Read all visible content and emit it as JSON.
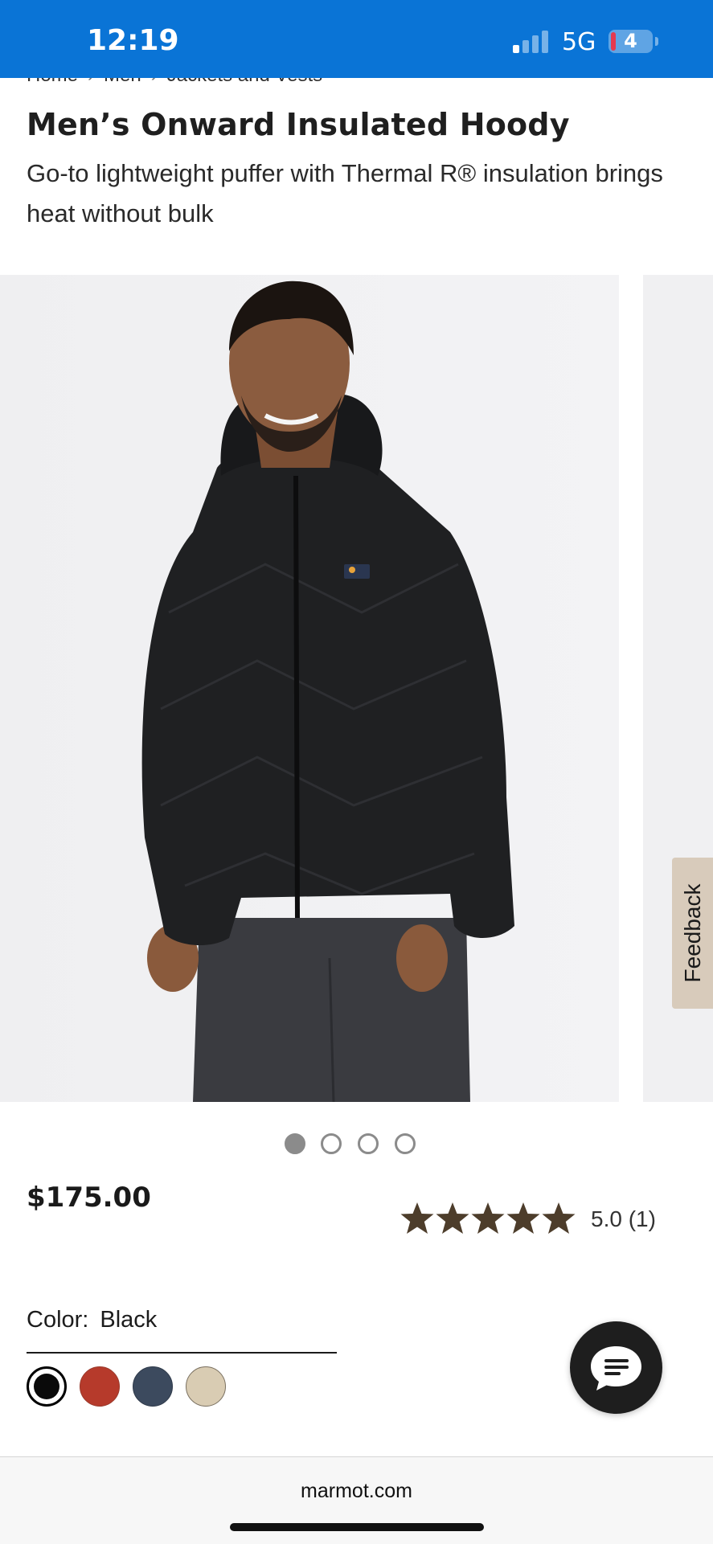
{
  "status_bar": {
    "time": "12:19",
    "network": "5G",
    "battery": "4"
  },
  "breadcrumb": {
    "items": [
      "Home",
      "Men",
      "Jackets and Vests"
    ]
  },
  "product": {
    "title": "Men’s Onward Insulated Hoody",
    "subtitle": "Go-to lightweight puffer with Thermal R® insulation brings heat without bulk",
    "price": "$175.00",
    "rating_value": 5.0,
    "rating_text": "5.0 (1)",
    "color_label": "Color:",
    "color_value": "Black",
    "swatches": [
      {
        "name": "Black",
        "color": "#0a0a0a"
      },
      {
        "name": "Red",
        "color": "#b63a2b"
      },
      {
        "name": "Navy",
        "color": "#3c4a5e"
      },
      {
        "name": "Khaki",
        "color": "#d9ccb3"
      }
    ]
  },
  "gallery": {
    "slide_count": 4,
    "active_index": 0
  },
  "feedback": {
    "label": "Feedback"
  },
  "browser": {
    "url": "marmot.com"
  },
  "colors": {
    "status_bar": "#0a74d6",
    "star": "#4d3d2b",
    "feedback_tab": "#d8cbbb"
  },
  "icons": {
    "chat": "chat-bubble-icon",
    "star": "star-icon"
  }
}
